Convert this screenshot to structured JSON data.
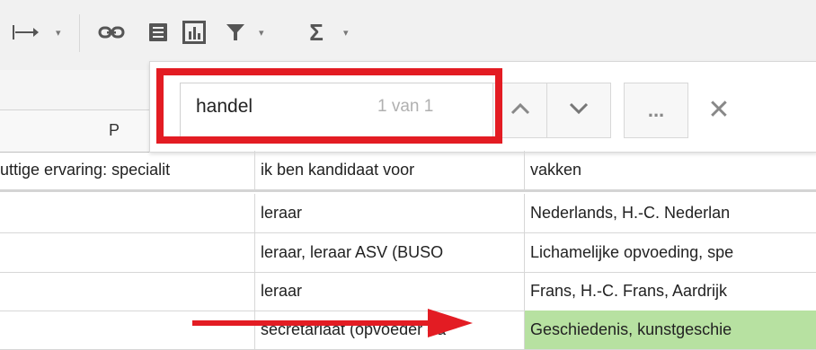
{
  "toolbar": {
    "icons": [
      "text-wrap-icon",
      "link-icon",
      "comment-icon",
      "chart-icon",
      "filter-icon",
      "sum-icon"
    ],
    "caret": "▾"
  },
  "column_header": {
    "label": "P"
  },
  "find": {
    "query": "handel",
    "count": "1 van 1",
    "more_label": "...",
    "close_label": "✕"
  },
  "table": {
    "header": [
      "uttige ervaring: specialit",
      "ik ben kandidaat voor",
      "vakken"
    ],
    "rows": [
      [
        "",
        "leraar",
        "Nederlands, H.-C. Nederlan"
      ],
      [
        "",
        "leraar, leraar ASV (BUSO",
        "Lichamelijke opvoeding, spe"
      ],
      [
        "",
        "leraar",
        "Frans, H.-C. Frans, Aardrijk"
      ],
      [
        "",
        "secretariaat (opvoeder - a",
        "Geschiedenis, kunstgeschie"
      ]
    ]
  },
  "colors": {
    "highlight": "#e31c23",
    "match": "#b7e1a1",
    "arrow": "#e31c23"
  }
}
